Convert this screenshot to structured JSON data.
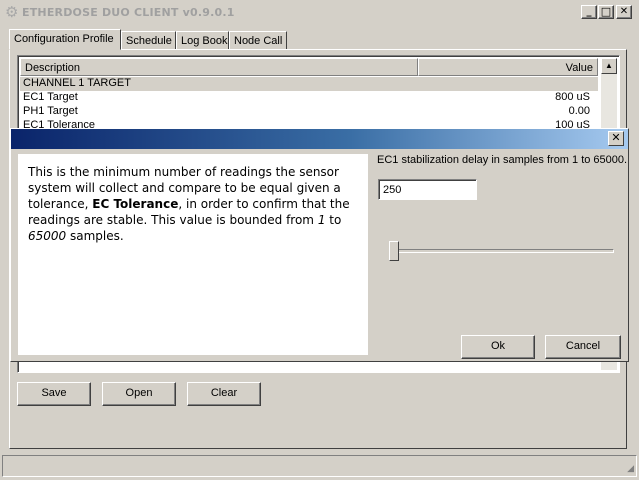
{
  "window": {
    "title": "ETHERDOSE DUO CLIENT v0.9.0.1",
    "minimize": "_",
    "maximize": "□",
    "close": "✕"
  },
  "tabs": [
    {
      "label": "Configuration Profile",
      "active": true
    },
    {
      "label": "Schedule",
      "active": false
    },
    {
      "label": "Log Book",
      "active": false
    },
    {
      "label": "Node Call",
      "active": false
    }
  ],
  "table": {
    "columns": [
      "Description",
      "Value"
    ],
    "rows": [
      {
        "desc": "CHANNEL 1 TARGET",
        "value": ""
      },
      {
        "desc": "EC1 Target",
        "value": "800 uS"
      },
      {
        "desc": "PH1 Target",
        "value": "0.00"
      },
      {
        "desc": "EC1 Tolerance",
        "value": "100 uS"
      }
    ],
    "scroll_up": "▲"
  },
  "buttons": {
    "save": "Save",
    "open": "Open",
    "clear": "Clear"
  },
  "dialog": {
    "close": "✕",
    "help": {
      "p1": "This is the minimum number of readings the sensor system will collect and compare to be equal given a tolerance, ",
      "bold": "EC Tolerance",
      "p2": ", in order to confirm that the readings are stable. This value is bounded from ",
      "min": "1",
      "p3": " to ",
      "max": "65000",
      "p4": " samples."
    },
    "prompt": "EC1 stabilization delay in samples from 1 to 65000.",
    "value": "250",
    "slider_fraction": 0.0038,
    "ok": "Ok",
    "cancel": "Cancel"
  }
}
